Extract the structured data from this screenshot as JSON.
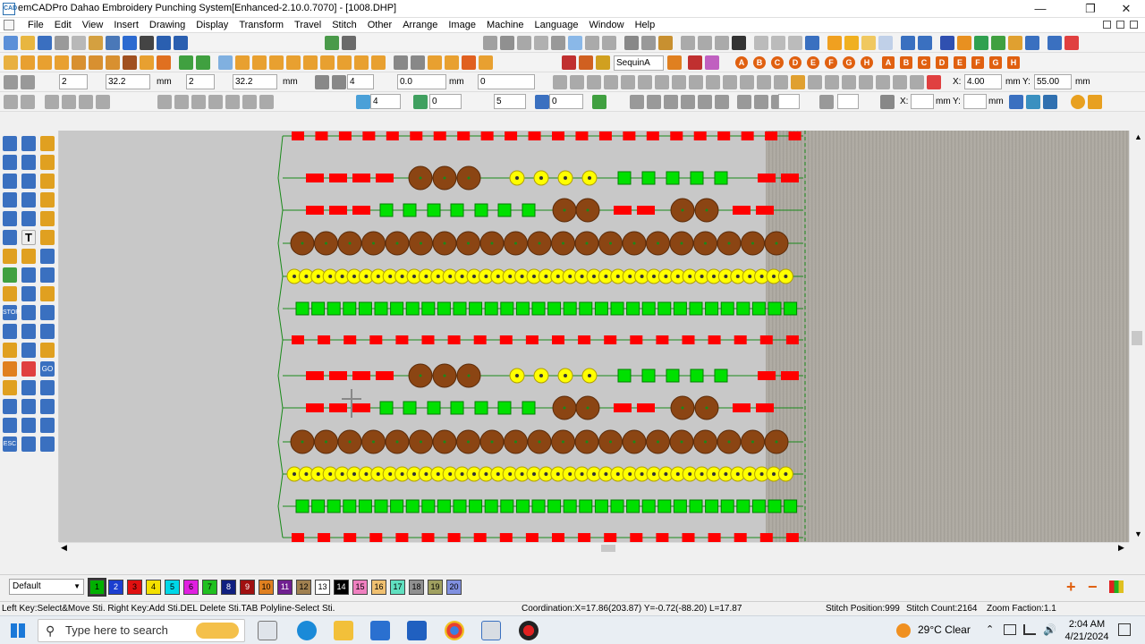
{
  "window": {
    "title": "emCADPro Dahao Embroidery Punching System[Enhanced-2.10.0.7070] - [1008.DHP]"
  },
  "menu": {
    "items": [
      "File",
      "Edit",
      "View",
      "Insert",
      "Drawing",
      "Display",
      "Transform",
      "Travel",
      "Stitch",
      "Other",
      "Arrange",
      "Image",
      "Machine",
      "Language",
      "Window",
      "Help"
    ]
  },
  "toolbar_letters": {
    "set_a": [
      "A",
      "B",
      "C",
      "D",
      "E",
      "F",
      "G",
      "H"
    ],
    "set_b": [
      "A",
      "B",
      "C",
      "D",
      "E",
      "F",
      "G",
      "H"
    ],
    "sequin_select": "SequinA"
  },
  "toolbar_fields": {
    "f1": "2",
    "f2": "32.2",
    "unit1": "mm",
    "f3": "2",
    "f4": "32.2",
    "unit2": "mm",
    "f5": "4",
    "f6": "0.0",
    "unit3": "mm",
    "f7": "0",
    "x_label": "X:",
    "x_value": "4.00",
    "x_unit": "mm",
    "y_label": "Y:",
    "y_value": "55.00",
    "y_unit": "mm",
    "g1": "4",
    "g2": "0",
    "g3": "5",
    "g4": "0",
    "x2_label": "X:",
    "x2_unit": "mm",
    "y2_label": "Y:",
    "y2_unit": "mm"
  },
  "left_tools": {
    "stop_label": "STOP",
    "go_label": "GO",
    "esc_label": "ESC",
    "text_tool": "T"
  },
  "colors": {
    "red_stitch": "#ff0000",
    "green_sequin": "#00e000",
    "yellow_sequin": "#ffff00",
    "brown_sequin": "#8b4513",
    "canvas_bg": "#c8c8c8"
  },
  "design_rows": [
    {
      "type": "red-dash",
      "count": 22
    },
    {
      "type": "mixed-a"
    },
    {
      "type": "mixed-b"
    },
    {
      "type": "brown",
      "count": 21
    },
    {
      "type": "yellow",
      "count": 42
    },
    {
      "type": "green",
      "count": 32
    },
    {
      "type": "red-dash",
      "count": 20
    },
    {
      "type": "mixed-a"
    },
    {
      "type": "mixed-b"
    },
    {
      "type": "brown",
      "count": 21
    },
    {
      "type": "yellow",
      "count": 42
    },
    {
      "type": "green",
      "count": 32
    },
    {
      "type": "red-dash",
      "count": 20
    }
  ],
  "bottom": {
    "style_select": "Default",
    "swatches": [
      {
        "n": "1",
        "c": "#00b000"
      },
      {
        "n": "2",
        "c": "#1c3fd0"
      },
      {
        "n": "3",
        "c": "#e01010"
      },
      {
        "n": "4",
        "c": "#f4e000"
      },
      {
        "n": "5",
        "c": "#00d8e8"
      },
      {
        "n": "6",
        "c": "#e020e0"
      },
      {
        "n": "7",
        "c": "#20c020"
      },
      {
        "n": "8",
        "c": "#102080"
      },
      {
        "n": "9",
        "c": "#a01010"
      },
      {
        "n": "10",
        "c": "#e08020"
      },
      {
        "n": "11",
        "c": "#702090"
      },
      {
        "n": "12",
        "c": "#a08050"
      },
      {
        "n": "13",
        "c": "#ffffff"
      },
      {
        "n": "14",
        "c": "#000000"
      },
      {
        "n": "15",
        "c": "#f080c0"
      },
      {
        "n": "16",
        "c": "#f0c070"
      },
      {
        "n": "17",
        "c": "#60e0c0"
      },
      {
        "n": "18",
        "c": "#909090"
      },
      {
        "n": "19",
        "c": "#a0a060"
      },
      {
        "n": "20",
        "c": "#8090e0"
      }
    ]
  },
  "status": {
    "help": "Left Key:Select&Move Sti. Right Key:Add Sti.DEL Delete Sti.TAB Polyline-Select Sti.",
    "coordination": "Coordination:X=17.86(203.87) Y=-0.72(-88.20) L=17.87",
    "stitch_position": "Stitch Position:999",
    "stitch_count": "Stitch Count:2164",
    "zoom": "Zoom Faction:1.1"
  },
  "taskbar": {
    "search_placeholder": "Type here to search",
    "weather": "29°C  Clear",
    "time": "2:04 AM",
    "date": "4/21/2024"
  }
}
